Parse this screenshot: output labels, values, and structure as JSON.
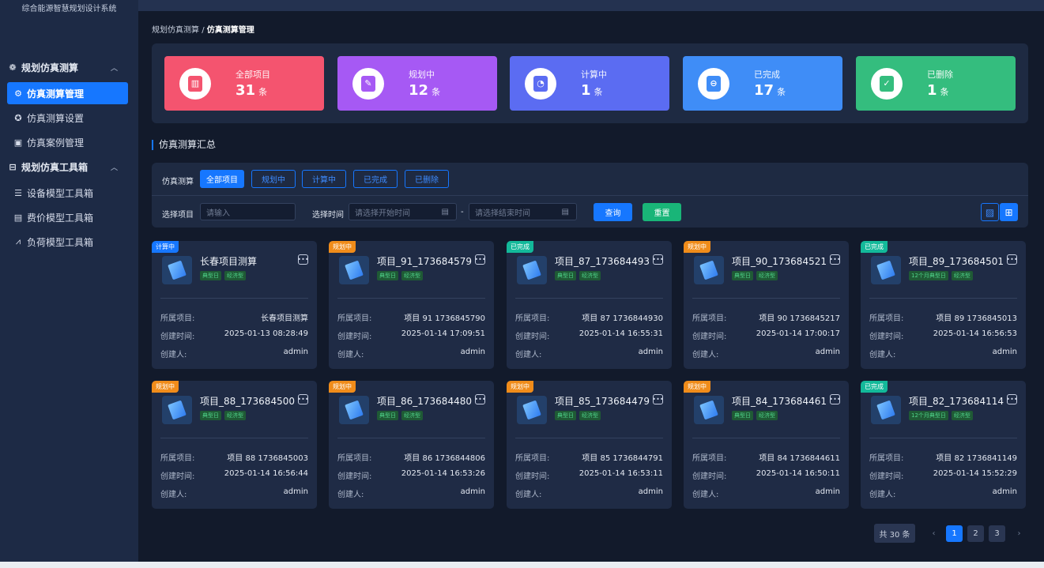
{
  "app": {
    "title": "综合能源智慧规划设计系统"
  },
  "sidebar": {
    "groups": [
      {
        "label": "规划仿真测算",
        "icon": "gear-icon",
        "items": [
          {
            "label": "仿真测算管理",
            "icon": "flow-icon",
            "active": true
          },
          {
            "label": "仿真测算设置",
            "icon": "settings-icon",
            "active": false
          },
          {
            "label": "仿真案例管理",
            "icon": "save-icon",
            "active": false
          }
        ]
      },
      {
        "label": "规划仿真工具箱",
        "icon": "toolbox-icon",
        "items": [
          {
            "label": "设备模型工具箱",
            "icon": "list-icon",
            "active": false
          },
          {
            "label": "费价模型工具箱",
            "icon": "price-icon",
            "active": false
          },
          {
            "label": "负荷模型工具箱",
            "icon": "chart-icon",
            "active": false
          }
        ]
      }
    ]
  },
  "breadcrumb": {
    "parent": "规划仿真测算",
    "sep": "/",
    "current": "仿真测算管理"
  },
  "stats": [
    {
      "label": "全部项目",
      "value": "31",
      "unit": "条",
      "color": "#f4546f",
      "icon": "chart-doc-icon"
    },
    {
      "label": "规划中",
      "value": "12",
      "unit": "条",
      "color": "#a659f4",
      "icon": "clipboard-icon"
    },
    {
      "label": "计算中",
      "value": "1",
      "unit": "条",
      "color": "#5b6cf2",
      "icon": "calc-clock-icon"
    },
    {
      "label": "已完成",
      "value": "17",
      "unit": "条",
      "color": "#3f8df7",
      "icon": "doc-minus-icon"
    },
    {
      "label": "已删除",
      "value": "1",
      "unit": "条",
      "color": "#34bd7e",
      "icon": "doc-check-icon"
    }
  ],
  "section_title": "仿真测算汇总",
  "filters": {
    "status_label": "仿真测算",
    "tabs": [
      "全部项目",
      "规划中",
      "计算中",
      "已完成",
      "已删除"
    ],
    "project_label": "选择项目",
    "project_placeholder": "请输入",
    "time_label": "选择时间",
    "start_placeholder": "请选择开始时间",
    "range_sep": "-",
    "end_placeholder": "请选择结束时间",
    "query_label": "查询",
    "reset_label": "重置"
  },
  "card_labels": {
    "project": "所属项目:",
    "created": "创建时间:",
    "creator": "创建人:"
  },
  "cards": [
    {
      "status": "计算中",
      "status_color": "#1677ff",
      "title": "长春项目测算",
      "tags": [
        "典型日",
        "经济型"
      ],
      "project": "长春项目测算",
      "created": "2025-01-13 08:28:49",
      "creator": "admin"
    },
    {
      "status": "规划中",
      "status_color": "#f08c1a",
      "title": "项目_91_1736845790",
      "tags": [
        "典型日",
        "经济型"
      ],
      "project": "项目 91 1736845790",
      "created": "2025-01-14 17:09:51",
      "creator": "admin"
    },
    {
      "status": "已完成",
      "status_color": "#13b99a",
      "title": "项目_87_1736844930",
      "tags": [
        "典型日",
        "经济型"
      ],
      "project": "项目 87 1736844930",
      "created": "2025-01-14 16:55:31",
      "creator": "admin"
    },
    {
      "status": "规划中",
      "status_color": "#f08c1a",
      "title": "项目_90_1736845217",
      "tags": [
        "典型日",
        "经济型"
      ],
      "project": "项目 90 1736845217",
      "created": "2025-01-14 17:00:17",
      "creator": "admin"
    },
    {
      "status": "已完成",
      "status_color": "#13b99a",
      "title": "项目_89_1736845013",
      "tags": [
        "12个月典型日",
        "经济型"
      ],
      "project": "项目 89 1736845013",
      "created": "2025-01-14 16:56:53",
      "creator": "admin"
    },
    {
      "status": "规划中",
      "status_color": "#f08c1a",
      "title": "项目_88_1736845003",
      "tags": [
        "典型日",
        "经济型"
      ],
      "project": "项目 88 1736845003",
      "created": "2025-01-14 16:56:44",
      "creator": "admin"
    },
    {
      "status": "规划中",
      "status_color": "#f08c1a",
      "title": "项目_86_1736844806",
      "tags": [
        "典型日",
        "经济型"
      ],
      "project": "项目 86 1736844806",
      "created": "2025-01-14 16:53:26",
      "creator": "admin"
    },
    {
      "status": "规划中",
      "status_color": "#f08c1a",
      "title": "项目_85_1736844791",
      "tags": [
        "典型日",
        "经济型"
      ],
      "project": "项目 85 1736844791",
      "created": "2025-01-14 16:53:11",
      "creator": "admin"
    },
    {
      "status": "规划中",
      "status_color": "#f08c1a",
      "title": "项目_84_1736844611",
      "tags": [
        "典型日",
        "经济型"
      ],
      "project": "项目 84 1736844611",
      "created": "2025-01-14 16:50:11",
      "creator": "admin"
    },
    {
      "status": "已完成",
      "status_color": "#13b99a",
      "title": "项目_82_1736841149",
      "tags": [
        "12个月典型日",
        "经济型"
      ],
      "project": "项目 82 1736841149",
      "created": "2025-01-14 15:52:29",
      "creator": "admin"
    }
  ],
  "pagination": {
    "total_label": "共 30 条",
    "pages": [
      "1",
      "2",
      "3"
    ],
    "current": "1",
    "prev": "‹",
    "next": "›"
  },
  "colors": {
    "accent": "#1677ff",
    "reset": "#19b578",
    "sidebar_bg": "#1d2a45",
    "page_bg": "#121a2b",
    "panel_bg": "#1e2a42"
  }
}
